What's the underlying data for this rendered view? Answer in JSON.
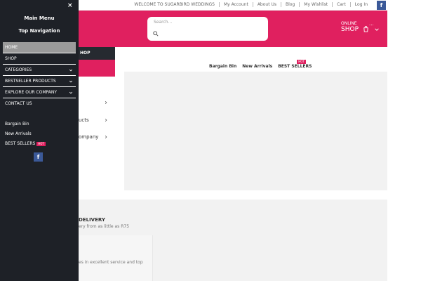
{
  "topbar": {
    "links": [
      "WELCOME TO SUGARBIRD WEDDINGS",
      "My Account",
      "About Us",
      "Blog",
      "My Wishlist",
      "Cart",
      "Log In"
    ],
    "facebook": "f"
  },
  "header": {
    "search_placeholder": "Search...",
    "shop_line1": "ONLINE",
    "shop_line2": "SHOP",
    "dots": "...",
    "brand_color": "#e0205f"
  },
  "background": {
    "shopbar_label": "HOP",
    "nav": [
      {
        "label": "Bargain Bin"
      },
      {
        "label": "New Arrivals"
      },
      {
        "label": "BEST SELLERS",
        "badge": "HOT"
      }
    ],
    "menu_fragments": [
      "ucts",
      "ompany"
    ],
    "delivery_title": "DELIVERY",
    "delivery_sub": "ery from as little as R75",
    "service_text": "es in excellent service and top"
  },
  "drawer": {
    "close": "×",
    "title_main": "Main Menu",
    "title_top": "Top Navigation",
    "items": [
      {
        "label": "HOME",
        "active": true,
        "has_children": false
      },
      {
        "label": "SHOP",
        "has_children": false
      },
      {
        "label": "CATEGORIES",
        "has_children": true
      },
      {
        "label": "BESTSELLER PRODUCTS",
        "has_children": true
      },
      {
        "label": "EXPLORE OUR COMPANY",
        "has_children": true
      },
      {
        "label": "CONTACT US",
        "has_children": false
      }
    ],
    "links": [
      "Bargain Bin",
      "New Arrivals",
      "BEST SELLERS"
    ],
    "hot_badge": "HOT",
    "facebook": "f"
  }
}
